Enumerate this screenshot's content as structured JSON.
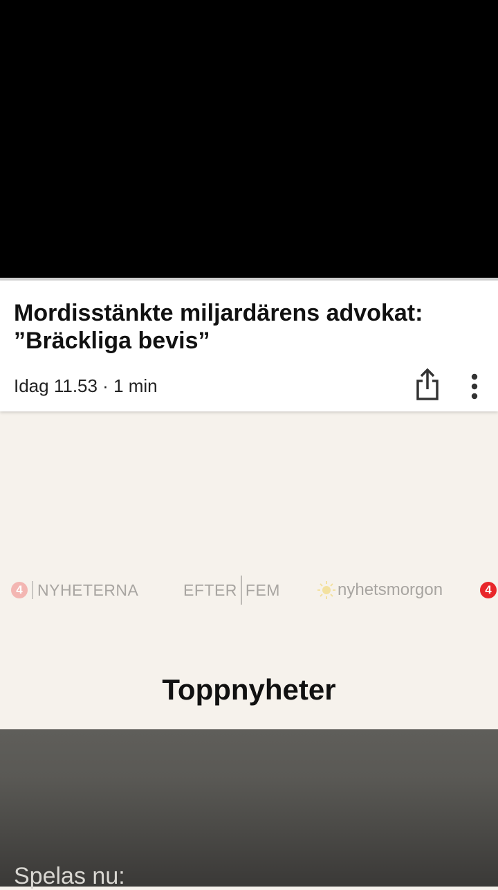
{
  "article": {
    "title": "Mordisstänkte miljardärens advokat: ”Bräckliga bevis”",
    "meta": "Idag 11.53 · 1 min",
    "share_icon": "share-icon",
    "more_icon": "more-vertical-icon"
  },
  "brands": {
    "nyheterna": {
      "badge": "4",
      "name": "NYHETERNA"
    },
    "efterfem": {
      "left": "EFTER",
      "right": "FEM"
    },
    "nyhetsmorgon": {
      "name": "nyhetsmorgon",
      "icon": "sun-icon"
    },
    "tv4": {
      "badge": "4"
    }
  },
  "section": {
    "title": "Toppnyheter"
  },
  "player": {
    "now_playing_label": "Spelas nu:"
  },
  "colors": {
    "player_bg": "#000000",
    "page_bg": "#f6f2ec",
    "card_bg": "#ffffff",
    "tv4_red": "#e8262a",
    "panel_bg": "#5f5e5a"
  }
}
